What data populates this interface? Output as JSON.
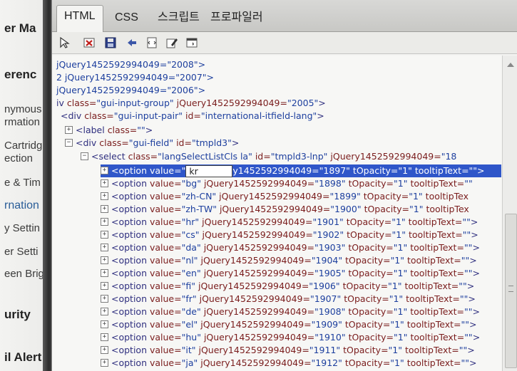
{
  "background_page": {
    "items": [
      {
        "text": "er Ma",
        "style": "bold"
      },
      {
        "text": "erenc",
        "style": "bold"
      },
      {
        "text": "nymous",
        "style": "norm"
      },
      {
        "text": "rmation",
        "style": "norm"
      },
      {
        "text": "Cartridg",
        "style": "norm"
      },
      {
        "text": "ection",
        "style": "norm"
      },
      {
        "text": "e & Tim",
        "style": "norm"
      },
      {
        "text": "rnation",
        "style": "blue"
      },
      {
        "text": "y Settin",
        "style": "norm"
      },
      {
        "text": "er Setti",
        "style": "norm"
      },
      {
        "text": "een Brig",
        "style": "norm"
      },
      {
        "text": "urity",
        "style": "bold"
      },
      {
        "text": "il Alert",
        "style": "bold"
      }
    ]
  },
  "devtools": {
    "tabs": [
      {
        "label": "HTML",
        "active": true
      },
      {
        "label": "CSS",
        "active": false
      },
      {
        "label": "스크립트",
        "active": false
      },
      {
        "label": "프로파일러",
        "active": false
      }
    ],
    "toolbar": {
      "icons": [
        "select-element-icon",
        "clear-icon",
        "save-icon",
        "refresh-icon",
        "dom-icon",
        "edit-icon",
        "view-source-icon"
      ]
    },
    "tree": {
      "lines": [
        {
          "indent": 0,
          "expander": "",
          "segments": [
            [
              "plain",
              " jQuery1452592994049=\"2008\">"
            ]
          ]
        },
        {
          "indent": 0,
          "expander": "",
          "segments": [
            [
              "plain",
              "2 jQuery1452592994049=\"2007\">"
            ]
          ]
        },
        {
          "indent": 0,
          "expander": "",
          "segments": [
            [
              "plain",
              " jQuery1452592994049=\"2006\">"
            ]
          ]
        },
        {
          "indent": 0,
          "expander": "",
          "segments": [
            [
              "tag",
              "iv "
            ],
            [
              "attr",
              "class="
            ],
            [
              "val",
              "\"gui-input-group\" "
            ],
            [
              "attr",
              "jQuery1452592994049="
            ],
            [
              "val",
              "\"2005\""
            ],
            [
              "tag",
              ">"
            ]
          ]
        },
        {
          "indent": 1,
          "expander": "",
          "segments": [
            [
              "tag",
              "<div "
            ],
            [
              "attr",
              "class="
            ],
            [
              "val",
              "\"gui-input-pair\" "
            ],
            [
              "attr",
              "id="
            ],
            [
              "val",
              "\"international-itfield-lang\""
            ],
            [
              "tag",
              ">"
            ]
          ]
        },
        {
          "indent": 2,
          "expander": "+",
          "segments": [
            [
              "tag",
              "<label "
            ],
            [
              "attr",
              "class="
            ],
            [
              "val",
              "\"\""
            ],
            [
              "tag",
              ">"
            ]
          ]
        },
        {
          "indent": 2,
          "expander": "-",
          "segments": [
            [
              "tag",
              "<div "
            ],
            [
              "attr",
              "class="
            ],
            [
              "val",
              "\"gui-field\" "
            ],
            [
              "attr",
              "id="
            ],
            [
              "val",
              "\"tmpld3\""
            ],
            [
              "tag",
              ">"
            ]
          ]
        },
        {
          "indent": 3,
          "expander": "-",
          "segments": [
            [
              "tag",
              "<select "
            ],
            [
              "attr",
              "class="
            ],
            [
              "val",
              "\"langSelectListCls la\" "
            ],
            [
              "attr",
              "id="
            ],
            [
              "val",
              "\"tmpld3-lnp\" "
            ],
            [
              "attr",
              "jQuery1452592994049="
            ],
            [
              "val",
              "\"18"
            ]
          ]
        },
        {
          "indent": 4,
          "expander": "+",
          "selected": true,
          "edit_value": "kr",
          "segments": [
            [
              "tag",
              "<option "
            ],
            [
              "attr",
              "value="
            ],
            [
              "val",
              "\""
            ],
            [
              "edit",
              ""
            ],
            [
              "attr",
              "y1452592994049="
            ],
            [
              "val",
              "\"1897\" "
            ],
            [
              "attr",
              "tOpacity="
            ],
            [
              "val",
              "\"1\" "
            ],
            [
              "attr",
              "tooltipText="
            ],
            [
              "val",
              "\"\""
            ],
            [
              "tag",
              ">"
            ]
          ]
        },
        {
          "indent": 4,
          "expander": "+",
          "segments": [
            [
              "tag",
              "<option "
            ],
            [
              "attr",
              "value="
            ],
            [
              "val",
              "\"bg\" "
            ],
            [
              "attr",
              "jQuery1452592994049="
            ],
            [
              "val",
              "\"1898\" "
            ],
            [
              "attr",
              "tOpacity="
            ],
            [
              "val",
              "\"1\" "
            ],
            [
              "attr",
              "tooltipText="
            ],
            [
              "val",
              "\"\""
            ]
          ]
        },
        {
          "indent": 4,
          "expander": "+",
          "segments": [
            [
              "tag",
              "<option "
            ],
            [
              "attr",
              "value="
            ],
            [
              "val",
              "\"zh-CN\" "
            ],
            [
              "attr",
              "jQuery1452592994049="
            ],
            [
              "val",
              "\"1899\" "
            ],
            [
              "attr",
              "tOpacity="
            ],
            [
              "val",
              "\"1\" "
            ],
            [
              "attr",
              "tooltipTex"
            ]
          ]
        },
        {
          "indent": 4,
          "expander": "+",
          "segments": [
            [
              "tag",
              "<option "
            ],
            [
              "attr",
              "value="
            ],
            [
              "val",
              "\"zh-TW\" "
            ],
            [
              "attr",
              "jQuery1452592994049="
            ],
            [
              "val",
              "\"1900\" "
            ],
            [
              "attr",
              "tOpacity="
            ],
            [
              "val",
              "\"1\" "
            ],
            [
              "attr",
              "tooltipTex"
            ]
          ]
        },
        {
          "indent": 4,
          "expander": "+",
          "segments": [
            [
              "tag",
              "<option "
            ],
            [
              "attr",
              "value="
            ],
            [
              "val",
              "\"hr\" "
            ],
            [
              "attr",
              "jQuery1452592994049="
            ],
            [
              "val",
              "\"1901\" "
            ],
            [
              "attr",
              "tOpacity="
            ],
            [
              "val",
              "\"1\" "
            ],
            [
              "attr",
              "tooltipText="
            ],
            [
              "val",
              "\"\""
            ],
            [
              "tag",
              ">"
            ]
          ]
        },
        {
          "indent": 4,
          "expander": "+",
          "segments": [
            [
              "tag",
              "<option "
            ],
            [
              "attr",
              "value="
            ],
            [
              "val",
              "\"cs\" "
            ],
            [
              "attr",
              "jQuery1452592994049="
            ],
            [
              "val",
              "\"1902\" "
            ],
            [
              "attr",
              "tOpacity="
            ],
            [
              "val",
              "\"1\" "
            ],
            [
              "attr",
              "tooltipText="
            ],
            [
              "val",
              "\"\""
            ],
            [
              "tag",
              ">"
            ]
          ]
        },
        {
          "indent": 4,
          "expander": "+",
          "segments": [
            [
              "tag",
              "<option "
            ],
            [
              "attr",
              "value="
            ],
            [
              "val",
              "\"da\" "
            ],
            [
              "attr",
              "jQuery1452592994049="
            ],
            [
              "val",
              "\"1903\" "
            ],
            [
              "attr",
              "tOpacity="
            ],
            [
              "val",
              "\"1\" "
            ],
            [
              "attr",
              "tooltipText="
            ],
            [
              "val",
              "\"\""
            ],
            [
              "tag",
              ">"
            ]
          ]
        },
        {
          "indent": 4,
          "expander": "+",
          "segments": [
            [
              "tag",
              "<option "
            ],
            [
              "attr",
              "value="
            ],
            [
              "val",
              "\"nl\" "
            ],
            [
              "attr",
              "jQuery1452592994049="
            ],
            [
              "val",
              "\"1904\" "
            ],
            [
              "attr",
              "tOpacity="
            ],
            [
              "val",
              "\"1\" "
            ],
            [
              "attr",
              "tooltipText="
            ],
            [
              "val",
              "\"\""
            ],
            [
              "tag",
              ">"
            ]
          ]
        },
        {
          "indent": 4,
          "expander": "+",
          "segments": [
            [
              "tag",
              "<option "
            ],
            [
              "attr",
              "value="
            ],
            [
              "val",
              "\"en\" "
            ],
            [
              "attr",
              "jQuery1452592994049="
            ],
            [
              "val",
              "\"1905\" "
            ],
            [
              "attr",
              "tOpacity="
            ],
            [
              "val",
              "\"1\" "
            ],
            [
              "attr",
              "tooltipText="
            ],
            [
              "val",
              "\"\""
            ],
            [
              "tag",
              ">"
            ]
          ]
        },
        {
          "indent": 4,
          "expander": "+",
          "segments": [
            [
              "tag",
              "<option "
            ],
            [
              "attr",
              "value="
            ],
            [
              "val",
              "\"fi\" "
            ],
            [
              "attr",
              "jQuery1452592994049="
            ],
            [
              "val",
              "\"1906\" "
            ],
            [
              "attr",
              "tOpacity="
            ],
            [
              "val",
              "\"1\" "
            ],
            [
              "attr",
              "tooltipText="
            ],
            [
              "val",
              "\"\""
            ],
            [
              "tag",
              ">"
            ]
          ]
        },
        {
          "indent": 4,
          "expander": "+",
          "segments": [
            [
              "tag",
              "<option "
            ],
            [
              "attr",
              "value="
            ],
            [
              "val",
              "\"fr\" "
            ],
            [
              "attr",
              "jQuery1452592994049="
            ],
            [
              "val",
              "\"1907\" "
            ],
            [
              "attr",
              "tOpacity="
            ],
            [
              "val",
              "\"1\" "
            ],
            [
              "attr",
              "tooltipText="
            ],
            [
              "val",
              "\"\""
            ],
            [
              "tag",
              ">"
            ]
          ]
        },
        {
          "indent": 4,
          "expander": "+",
          "segments": [
            [
              "tag",
              "<option "
            ],
            [
              "attr",
              "value="
            ],
            [
              "val",
              "\"de\" "
            ],
            [
              "attr",
              "jQuery1452592994049="
            ],
            [
              "val",
              "\"1908\" "
            ],
            [
              "attr",
              "tOpacity="
            ],
            [
              "val",
              "\"1\" "
            ],
            [
              "attr",
              "tooltipText="
            ],
            [
              "val",
              "\"\""
            ],
            [
              "tag",
              ">"
            ]
          ]
        },
        {
          "indent": 4,
          "expander": "+",
          "segments": [
            [
              "tag",
              "<option "
            ],
            [
              "attr",
              "value="
            ],
            [
              "val",
              "\"el\" "
            ],
            [
              "attr",
              "jQuery1452592994049="
            ],
            [
              "val",
              "\"1909\" "
            ],
            [
              "attr",
              "tOpacity="
            ],
            [
              "val",
              "\"1\" "
            ],
            [
              "attr",
              "tooltipText="
            ],
            [
              "val",
              "\"\""
            ],
            [
              "tag",
              ">"
            ]
          ]
        },
        {
          "indent": 4,
          "expander": "+",
          "segments": [
            [
              "tag",
              "<option "
            ],
            [
              "attr",
              "value="
            ],
            [
              "val",
              "\"hu\" "
            ],
            [
              "attr",
              "jQuery1452592994049="
            ],
            [
              "val",
              "\"1910\" "
            ],
            [
              "attr",
              "tOpacity="
            ],
            [
              "val",
              "\"1\" "
            ],
            [
              "attr",
              "tooltipText="
            ],
            [
              "val",
              "\"\""
            ],
            [
              "tag",
              ">"
            ]
          ]
        },
        {
          "indent": 4,
          "expander": "+",
          "segments": [
            [
              "tag",
              "<option "
            ],
            [
              "attr",
              "value="
            ],
            [
              "val",
              "\"it\" "
            ],
            [
              "attr",
              "jQuery1452592994049="
            ],
            [
              "val",
              "\"1911\" "
            ],
            [
              "attr",
              "tOpacity="
            ],
            [
              "val",
              "\"1\" "
            ],
            [
              "attr",
              "tooltipText="
            ],
            [
              "val",
              "\"\""
            ],
            [
              "tag",
              ">"
            ]
          ]
        },
        {
          "indent": 4,
          "expander": "+",
          "segments": [
            [
              "tag",
              "<option "
            ],
            [
              "attr",
              "value="
            ],
            [
              "val",
              "\"ja\" "
            ],
            [
              "attr",
              "jQuery1452592994049="
            ],
            [
              "val",
              "\"1912\" "
            ],
            [
              "attr",
              "tOpacity="
            ],
            [
              "val",
              "\"1\" "
            ],
            [
              "attr",
              "tooltipText="
            ],
            [
              "val",
              "\"\""
            ],
            [
              "tag",
              ">"
            ]
          ]
        }
      ]
    }
  }
}
